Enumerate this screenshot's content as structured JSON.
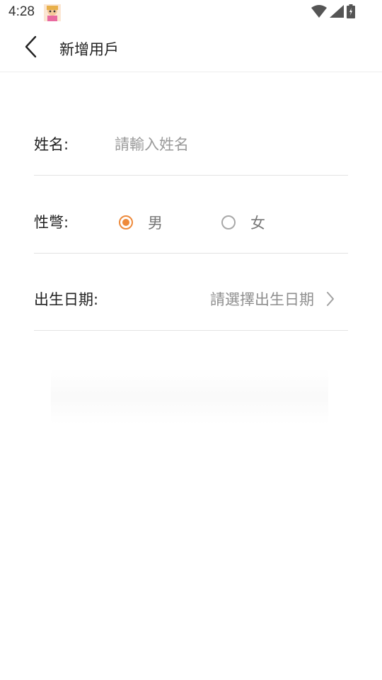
{
  "status_bar": {
    "time": "4:28",
    "icons": [
      "app-avatar-icon",
      "wifi-icon",
      "signal-icon",
      "battery-icon"
    ]
  },
  "toolbar": {
    "back_icon": "chevron-left-icon",
    "title": "新增用戶"
  },
  "form": {
    "name": {
      "label": "姓名:",
      "value": "",
      "placeholder": "請輸入姓名"
    },
    "gender": {
      "label": "性彆:",
      "options": [
        {
          "label": "男",
          "checked": true
        },
        {
          "label": "女",
          "checked": false
        }
      ]
    },
    "birthdate": {
      "label": "出生日期:",
      "placeholder": "請選擇出生日期",
      "icon": "chevron-right-icon"
    }
  },
  "colors": {
    "accent": "#ee8a3b",
    "divider": "#e3e3e3",
    "placeholder": "#9a9a9a"
  }
}
